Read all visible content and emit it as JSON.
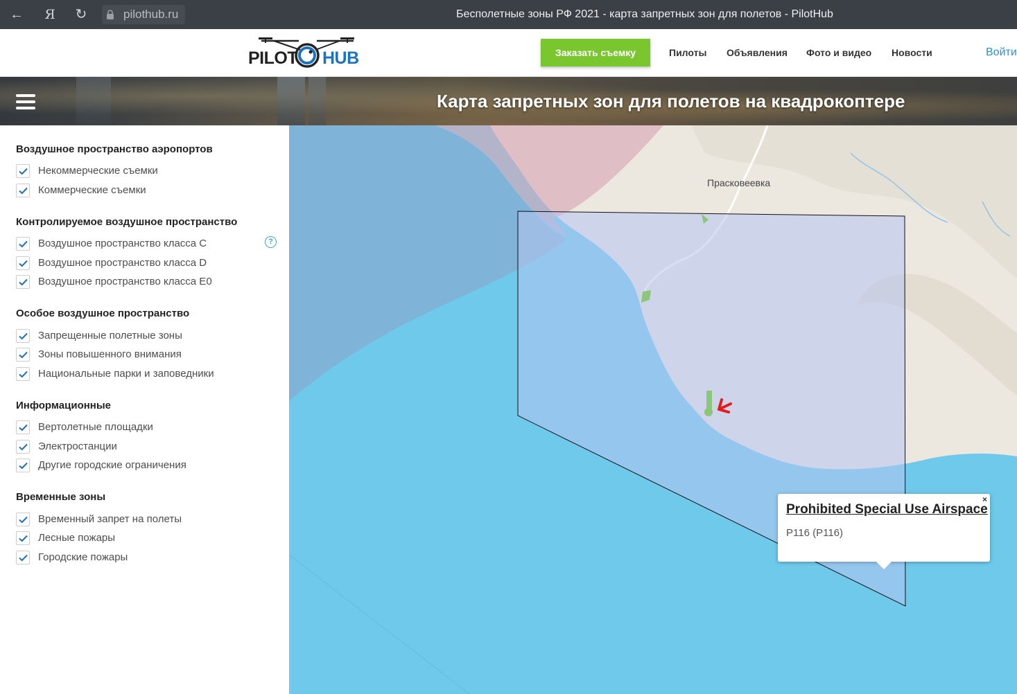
{
  "browser": {
    "address": "pilothub.ru",
    "tab_title": "Бесполетные зоны РФ 2021 - карта запретных зон для полетов - PilotHub"
  },
  "header": {
    "logo_left": "PILOT",
    "logo_right": "HUB",
    "cta_label": "Заказать съемку",
    "menu": [
      "Пилоты",
      "Объявления",
      "Фото и видео",
      "Новости"
    ],
    "login_label": "Войти"
  },
  "hero": {
    "title": "Карта запретных зон для полетов на квадрокоптере"
  },
  "sidebar": {
    "groups": [
      {
        "title": "Воздушное пространство аэропортов",
        "items": [
          {
            "label": "Некоммерческие съемки",
            "checked": true
          },
          {
            "label": "Коммерческие съемки",
            "checked": true
          }
        ]
      },
      {
        "title": "Контролируемое воздушное пространство",
        "items": [
          {
            "label": "Воздушное пространство класса C",
            "checked": true
          },
          {
            "label": "Воздушное пространство класса D",
            "checked": true
          },
          {
            "label": "Воздушное пространство класса E0",
            "checked": true
          }
        ]
      },
      {
        "title": "Особое воздушное пространство",
        "items": [
          {
            "label": "Запрещенные полетные зоны",
            "checked": true
          },
          {
            "label": "Зоны повышенного внимания",
            "checked": true
          },
          {
            "label": "Национальные парки и заповедники",
            "checked": true
          }
        ]
      },
      {
        "title": "Информационные",
        "items": [
          {
            "label": "Вертолетные площадки",
            "checked": true
          },
          {
            "label": "Электростанции",
            "checked": true
          },
          {
            "label": "Другие городские ограничения",
            "checked": true
          }
        ]
      },
      {
        "title": "Временные зоны",
        "items": [
          {
            "label": "Временный запрет на полеты",
            "checked": true
          },
          {
            "label": "Лесные пожары",
            "checked": true
          },
          {
            "label": "Городские пожары",
            "checked": true
          }
        ]
      }
    ],
    "help_symbol": "?"
  },
  "map": {
    "place_label": "Прасковеевка",
    "popup": {
      "title": "Prohibited Special Use Airspace",
      "subtitle": "P116 (P116)",
      "close_symbol": "×"
    }
  },
  "colors": {
    "accent_green": "#7ac62f",
    "link_blue": "#2f8fd8",
    "sea": "#6ec9ea",
    "zone_overlay": "#b7c5f0",
    "restricted_pink": "#d9a7b9",
    "checkbox_check": "#1f6fb8"
  }
}
